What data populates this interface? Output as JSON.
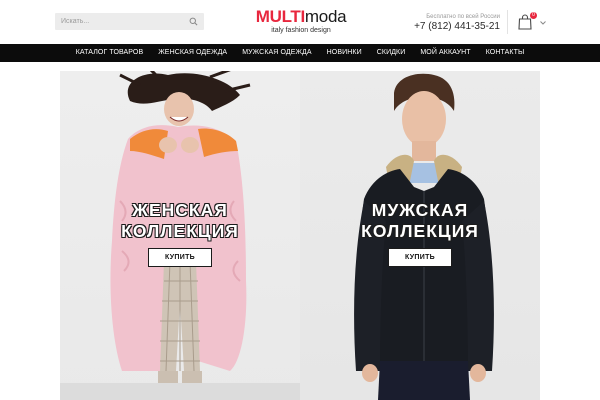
{
  "header": {
    "search": {
      "placeholder": "Искать..."
    },
    "logo": {
      "part1": "MULTI",
      "part2": "moda",
      "tagline": "italy fashion design"
    },
    "contact": {
      "label": "Бесплатно по всей России",
      "phone": "+7 (812) 441-35-21"
    },
    "cart": {
      "count": "0"
    }
  },
  "nav": {
    "items": [
      {
        "label": "Каталог товаров"
      },
      {
        "label": "Женская одежда"
      },
      {
        "label": "Мужская одежда"
      },
      {
        "label": "Новинки"
      },
      {
        "label": "Скидки"
      },
      {
        "label": "Мой аккаунт"
      },
      {
        "label": "Контакты"
      }
    ]
  },
  "banners": [
    {
      "line1": "Женская",
      "line2": "коллекция",
      "button": "Купить"
    },
    {
      "line1": "Мужская",
      "line2": "коллекция",
      "button": "Купить"
    }
  ],
  "colors": {
    "brand": "#e8273e",
    "nav_bg": "#0c0c0c",
    "text": "#1a1a1a"
  },
  "icons": {
    "search": "search-icon",
    "cart": "shopping-bag-icon",
    "dropdown": "chevron-down-icon"
  }
}
